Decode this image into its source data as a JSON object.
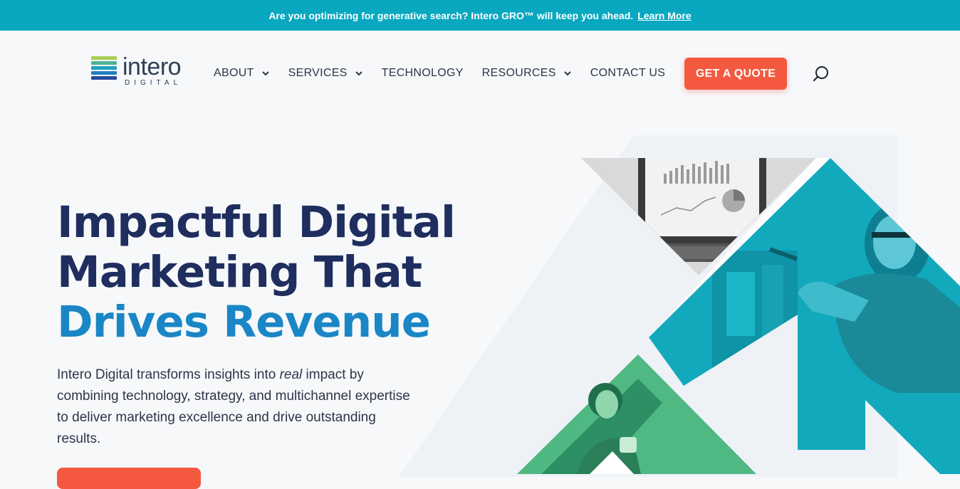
{
  "announcement": {
    "text": "Are you optimizing for generative search? Intero GRO™ will keep you ahead.",
    "link_label": "Learn More"
  },
  "logo": {
    "word": "intero",
    "sub": "DIGITAL",
    "bar_colors": [
      "#a9cf54",
      "#4db594",
      "#1ea1bf",
      "#1f7fc0",
      "#27489c"
    ]
  },
  "nav": {
    "items": [
      {
        "label": "ABOUT",
        "has_dropdown": true
      },
      {
        "label": "SERVICES",
        "has_dropdown": true
      },
      {
        "label": "TECHNOLOGY",
        "has_dropdown": false
      },
      {
        "label": "RESOURCES",
        "has_dropdown": true
      },
      {
        "label": "CONTACT US",
        "has_dropdown": false
      }
    ],
    "cta_label": "GET A QUOTE",
    "search_icon": "search-icon"
  },
  "hero": {
    "headline_line1": "Impactful Digital",
    "headline_line2": "Marketing That",
    "headline_accent": "Drives Revenue",
    "body_before": "Intero Digital transforms insights into ",
    "body_em": "real",
    "body_after": " impact by combining technology, strategy, and multichannel expertise to deliver marketing excellence and drive outstanding results."
  },
  "colors": {
    "announce_bg": "#0aa8c0",
    "navy": "#1f2e5e",
    "accent_blue": "#1a86c5",
    "cta_orange": "#f4593f",
    "teal": "#12a9bd",
    "green": "#4fb883"
  }
}
